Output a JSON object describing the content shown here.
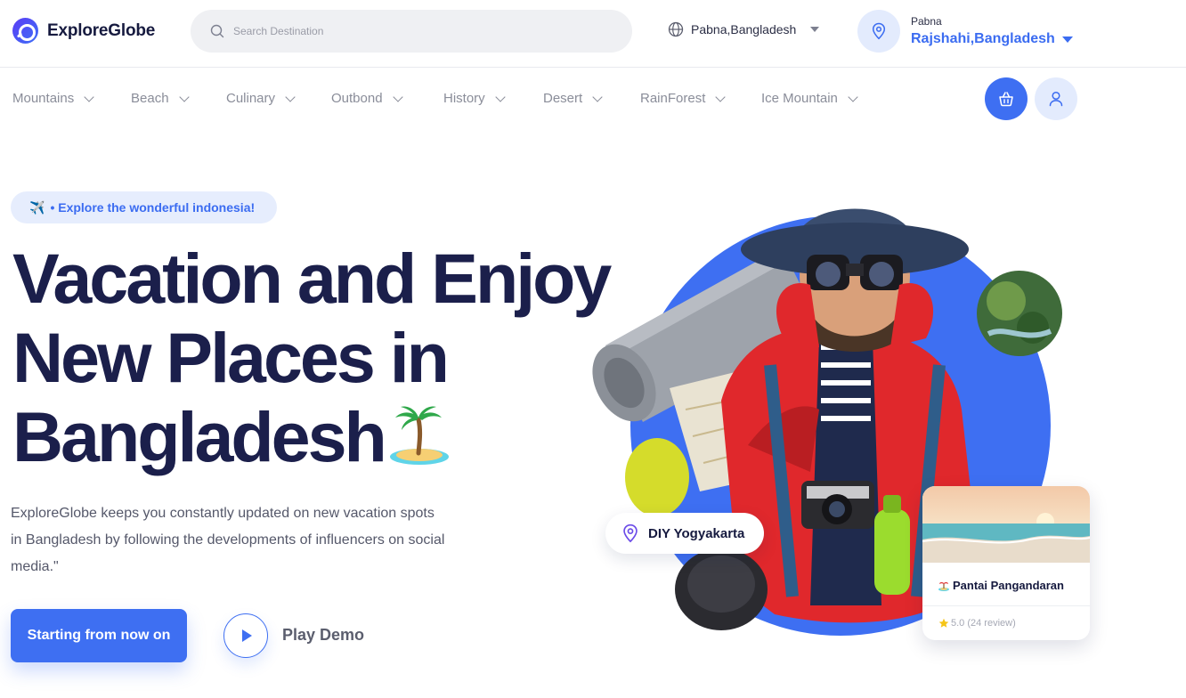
{
  "header": {
    "brand": "ExploreGlobe",
    "search_placeholder": "Search Destination",
    "language_location": "Pabna,Bangladesh",
    "location_small": "Pabna",
    "location_main": "Rajshahi,Bangladesh"
  },
  "nav": {
    "items": [
      {
        "label": "Mountains"
      },
      {
        "label": "Beach"
      },
      {
        "label": "Culinary"
      },
      {
        "label": "Outbond"
      },
      {
        "label": "History"
      },
      {
        "label": "Desert"
      },
      {
        "label": "RainForest"
      },
      {
        "label": "Ice Mountain"
      }
    ]
  },
  "hero": {
    "badge_icon": "✈️",
    "badge_text": "• Explore the wonderful indonesia!",
    "title_lines": [
      "Vacation and Enjoy",
      "New Places in",
      "Bangladesh"
    ],
    "description": "ExploreGlobe keeps you constantly updated on new vacation spots in Bangladesh by following the developments of influencers on social media.\"",
    "cta_label": "Starting from now on",
    "play_label": "Play Demo"
  },
  "cards": {
    "diy_label": "DIY Yogyakarta",
    "beach_name": "Pantai Pangandaran",
    "beach_rating": "5.0 (24 review)"
  },
  "colors": {
    "primary": "#3e6ff2",
    "primary_soft": "#e3ebfd",
    "heading": "#1b1f4b",
    "muted": "#8a8d99"
  },
  "icons": [
    "logo-icon",
    "search-icon",
    "globe-icon",
    "location-pin-icon",
    "chevron-down-icon",
    "basket-icon",
    "user-icon",
    "play-icon",
    "island-emoji-icon",
    "star-icon"
  ]
}
